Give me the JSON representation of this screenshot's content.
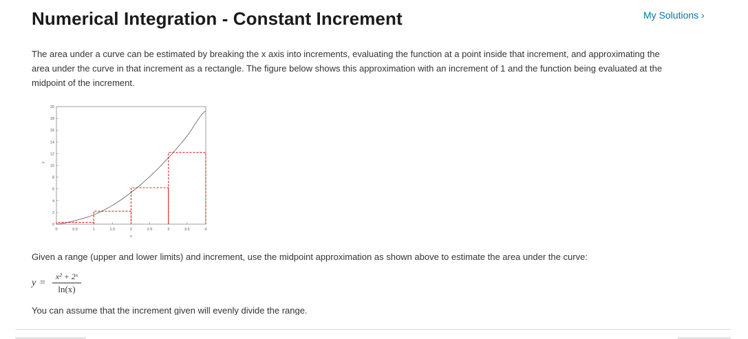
{
  "header": {
    "title": "Numerical Integration - Constant Increment",
    "my_solutions_label": "My Solutions ›"
  },
  "intro": {
    "text": "The area under a curve can be estimated by breaking the x axis into increments, evaluating the function at a point inside that increment, and approximating the area under the curve in that increment as a rectangle. The figure below shows this approximation with an increment of 1 and the function being evaluated at the midpoint of the increment."
  },
  "chart_data": {
    "type": "line",
    "xlabel": "x",
    "ylabel": "y",
    "xlim": [
      0,
      4
    ],
    "ylim": [
      0,
      20
    ],
    "x_ticks": [
      "0",
      "0.5",
      "1",
      "1.5",
      "2",
      "2.5",
      "3",
      "3.5",
      "4"
    ],
    "y_ticks": [
      "0",
      "2",
      "4",
      "6",
      "8",
      "10",
      "12",
      "14",
      "16",
      "18",
      "20"
    ],
    "grid": false,
    "curve": {
      "color": "#444444",
      "x": [
        0,
        0.5,
        1,
        1.5,
        2,
        2.5,
        3,
        3.5,
        4
      ],
      "y": [
        0,
        0.6,
        1.6,
        3.2,
        5.4,
        8.1,
        11.3,
        15.0,
        19.3
      ]
    },
    "rectangles": {
      "color": "#e02020",
      "style": "dashed",
      "x_start": [
        0,
        1,
        2,
        3
      ],
      "x_end": [
        1,
        2,
        3,
        4
      ],
      "height": [
        0.3,
        2.2,
        6.2,
        12.2
      ]
    }
  },
  "body": {
    "given_text": "Given a range (upper and lower limits) and increment, use the midpoint approximation as shown above to estimate the area under the curve:",
    "equation": {
      "lhs": "y",
      "equals": "=",
      "numerator": "x² + 2ˣ",
      "denominator": "ln(x)"
    },
    "assume_text": "You can assume that the increment given will evenly divide the range."
  }
}
